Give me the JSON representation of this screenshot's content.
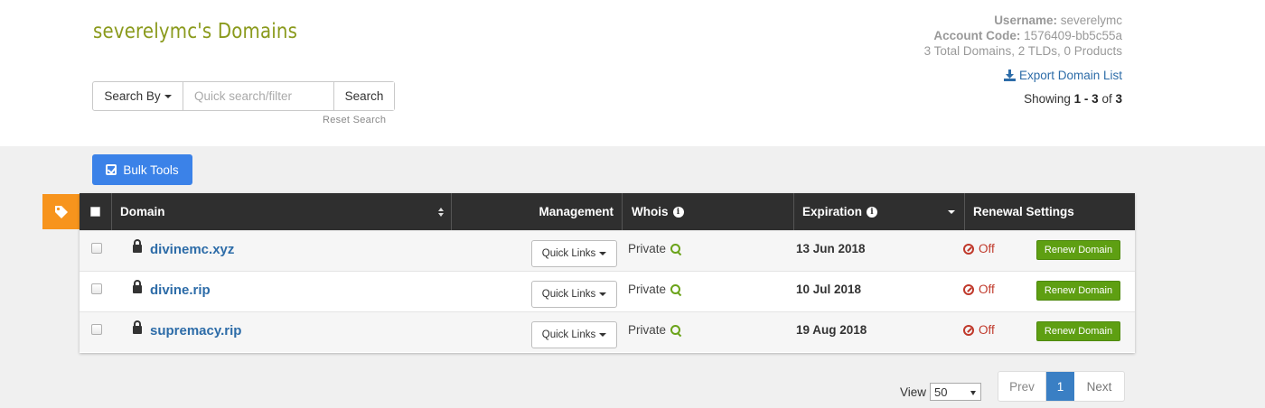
{
  "header": {
    "title": "severelymc's Domains"
  },
  "search": {
    "search_by_label": "Search By",
    "placeholder": "Quick search/filter",
    "value": "",
    "button_label": "Search",
    "reset_label": "Reset Search"
  },
  "account": {
    "username_label": "Username:",
    "username": "severelymc",
    "account_code_label": "Account Code:",
    "account_code": "1576409-bb5c55a",
    "summary": "3 Total Domains, 2 TLDs, 0 Products",
    "export_label": "Export Domain List",
    "showing_prefix": "Showing",
    "showing_range": "1 - 3",
    "showing_of": "of",
    "showing_total": "3"
  },
  "toolbar": {
    "bulk_tools_label": "Bulk Tools"
  },
  "table": {
    "columns": {
      "domain": "Domain",
      "management": "Management",
      "whois": "Whois",
      "expiration": "Expiration",
      "renewal": "Renewal Settings"
    },
    "rows": [
      {
        "domain": "divinemc.xyz",
        "quick_links": "Quick Links",
        "whois": "Private",
        "expiration": "13 Jun 2018",
        "renewal_status": "Off",
        "renew_label": "Renew Domain"
      },
      {
        "domain": "divine.rip",
        "quick_links": "Quick Links",
        "whois": "Private",
        "expiration": "10 Jul 2018",
        "renewal_status": "Off",
        "renew_label": "Renew Domain"
      },
      {
        "domain": "supremacy.rip",
        "quick_links": "Quick Links",
        "whois": "Private",
        "expiration": "19 Aug 2018",
        "renewal_status": "Off",
        "renew_label": "Renew Domain"
      }
    ]
  },
  "pagination": {
    "view_label": "View",
    "per_page": "50",
    "prev_label": "Prev",
    "current_page": "1",
    "next_label": "Next"
  },
  "colors": {
    "title": "#8a9a1c",
    "link": "#2d6ca8",
    "bulk_button": "#3b82e8",
    "tag_tab": "#f7941d",
    "table_header": "#2f2f2f",
    "renew_button": "#5e9f12",
    "renewal_off": "#c0392b",
    "active_page": "#3a7fc4"
  }
}
